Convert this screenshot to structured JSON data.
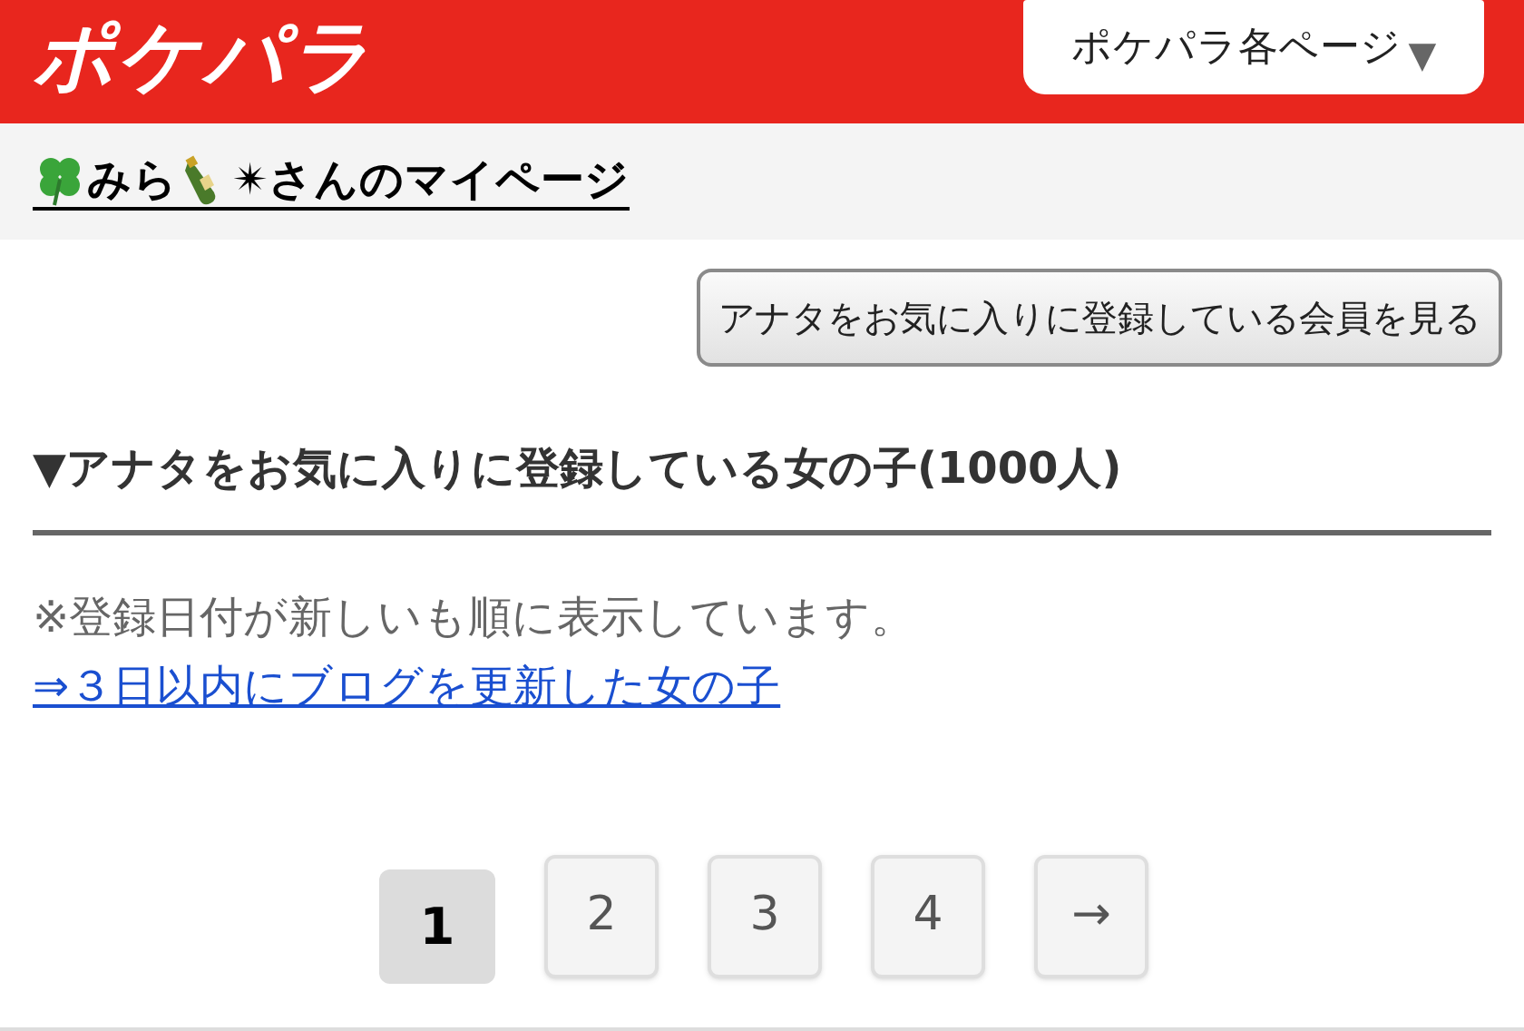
{
  "header": {
    "logo": "ポケパラ",
    "menu_button": "ポケパラ各ページ",
    "menu_caret": "▼"
  },
  "mypage": {
    "name": "みら",
    "suffix": "✴さんのマイページ"
  },
  "action_button": "アナタをお気に入りに登録している会員を見る",
  "section": {
    "title": "▼アナタをお気に入りに登録している女の子(1000人)",
    "note": "※登録日付が新しいも順に表示しています。",
    "link": "⇒３日以内にブログを更新した女の子"
  },
  "pagination": [
    {
      "label": "1",
      "selected": true
    },
    {
      "label": "2",
      "selected": false
    },
    {
      "label": "3",
      "selected": false
    },
    {
      "label": "4",
      "selected": false
    },
    {
      "label": "→",
      "selected": false
    }
  ]
}
